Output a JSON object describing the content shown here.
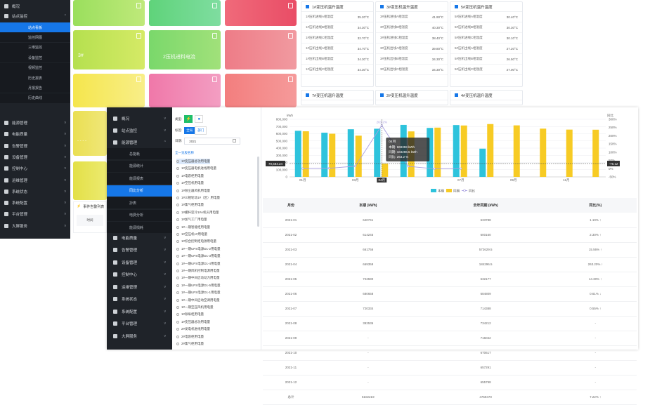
{
  "back": {
    "sidebar": [
      {
        "label": "概况",
        "chev": ""
      },
      {
        "label": "站点监控",
        "chev": "^"
      }
    ],
    "sidebar_sub": [
      "站点看板",
      "监控网图",
      "三维监控",
      "设备监控",
      "视频监控",
      "历史报表",
      "月报报告",
      "历史曲线"
    ],
    "sidebar_bottom": [
      "能源管理",
      "电能质量",
      "告警管理",
      "设备管理",
      "控制中心",
      "运维管理",
      "系统状态",
      "系统配置",
      "平台管理",
      "大屏服务"
    ],
    "tile_text_a": "3#",
    "tile_text_b": "2压机进料电流",
    "event_label": "事件告警列表",
    "event_time": "时间",
    "cards_top": [
      {
        "title": "1#变压机温升温度",
        "rows": [
          {
            "k": "1#压机进线A相温度",
            "v": "35.20°C"
          },
          {
            "k": "1#压机进线B相温度",
            "v": "34.30°C"
          },
          {
            "k": "1#压机进线C相温度",
            "v": "32.70°C"
          },
          {
            "k": "1#压机出线A相温度",
            "v": "34.70°C"
          },
          {
            "k": "1#压机出线B相温度",
            "v": "34.30°C"
          },
          {
            "k": "1#压机出线C相温度",
            "v": "34.30°C"
          }
        ]
      },
      {
        "title": "3#变压机温升温度",
        "rows": [
          {
            "k": "3#压机进线A相温度",
            "v": "41.90°C"
          },
          {
            "k": "3#压机进线B相温度",
            "v": "40.30°C"
          },
          {
            "k": "3#压机进线C相温度",
            "v": "38.40°C"
          },
          {
            "k": "3#压机出线A相温度",
            "v": "39.80°C"
          },
          {
            "k": "3#压机出线B相温度",
            "v": "34.30°C"
          },
          {
            "k": "3#压机出线C相温度",
            "v": "34.30°C"
          }
        ]
      },
      {
        "title": "5#变压机温升温度",
        "rows": [
          {
            "k": "5#压机进线A相温度",
            "v": "30.40°C"
          },
          {
            "k": "5#压机进线B相温度",
            "v": "30.30°C"
          },
          {
            "k": "5#压机进线C相温度",
            "v": "30.10°C"
          },
          {
            "k": "5#压机出线A相温度",
            "v": "27.20°C"
          },
          {
            "k": "5#压机出线B相温度",
            "v": "26.50°C"
          },
          {
            "k": "5#压机出线C相温度",
            "v": "27.00°C"
          }
        ]
      }
    ],
    "cards_bottom": [
      "7#变压机温升温度",
      "2#变压机温升温度",
      "4#变压机温升温度"
    ]
  },
  "front": {
    "sidebar": [
      {
        "label": "概况",
        "chev": "v"
      },
      {
        "label": "站点监控",
        "chev": "v"
      },
      {
        "label": "能源管理",
        "chev": "^"
      }
    ],
    "sidebar_sub": [
      "总能耗",
      "能源统计",
      "能源报表",
      "同比分析",
      "抄表",
      "电费分析",
      "能源损耗"
    ],
    "sidebar_bottom": [
      "电能质量",
      "告警管理",
      "设备管理",
      "控制中心",
      "运维管理",
      "系统状态",
      "系统配置",
      "平台管理",
      "大屏服务"
    ],
    "filter": {
      "type_label": "类型:",
      "tab_label": "标签:",
      "tab_all": "全局",
      "tab_dept": "部门",
      "date_label": "日期:",
      "date_value": "2021"
    },
    "tree_header": "全一览股名称",
    "tree_items": [
      "1#变压器总功用电量",
      "1#变压器电机进线用电量",
      "1#电容柜用电量",
      "1#空压机用电量",
      "1#除尘器风机用电量",
      "1#三相轮动1#（区）用电量",
      "1#集气柜用电量",
      "1#螺杆空冷1#A机头用电量",
      "1#加气工厂用电量",
      "1#一期智能柜用电量",
      "1#空压机1#用电量",
      "1#综合控制柜电源用电量",
      "1#一期UPS电源D1-2用电量",
      "1#一期UPS电源D1-3用电量",
      "1#一期UPS电源D1-4用电量",
      "1#一期风机控制电源用电量",
      "1#一期中间启动动力用电量",
      "1#一期UPS电源D1-5用电量",
      "1#一期UPS电源D1-1用电量",
      "1#一期中间启动空调用电量",
      "1#一期空压风机用电量",
      "1#除垢柜用电量",
      "1#变压器总功用电量",
      "2#发电机进线用电量",
      "2#电容柜用电量",
      "2#集气柜用电量"
    ],
    "tree_selected_index": 0,
    "table": {
      "headers": [
        "月份",
        "本期 (kWh)",
        "去年同期 (kWh)",
        "同比(%)"
      ],
      "rows": [
        [
          "2021-01",
          "640741",
          "633788",
          "1.10% ↑",
          "up"
        ],
        [
          "2021-02",
          "614245",
          "600160",
          "2.30% ↑",
          "up"
        ],
        [
          "2021-03",
          "661756",
          "572629.5",
          "15.56% ↑",
          "up"
        ],
        [
          "2021-04",
          "669359",
          "184296.5",
          "263.20% ↑",
          "up"
        ],
        [
          "2021-05",
          "722590",
          "632177",
          "14.30% ↑",
          "up"
        ],
        [
          "2021-06",
          "680658",
          "684809",
          "0.61% ↓",
          "dn"
        ],
        [
          "2021-07",
          "720334",
          "714388",
          "0.55% ↑",
          "up"
        ],
        [
          "2021-08",
          "392536",
          "734212",
          "-",
          ""
        ],
        [
          "2021-09",
          "-",
          "716042",
          "-",
          ""
        ],
        [
          "2021-10",
          "-",
          "670617",
          "-",
          ""
        ],
        [
          "2021-11",
          "-",
          "657291",
          "-",
          ""
        ],
        [
          "2021-12",
          "-",
          "655798",
          "-",
          ""
        ],
        [
          "总计",
          "5102219",
          "4759470",
          "7.22% ↑",
          "up"
        ]
      ]
    }
  },
  "chart_data": {
    "type": "bar",
    "categories": [
      "01月",
      "02月",
      "03月",
      "04月",
      "05月",
      "06月",
      "07月",
      "08月",
      "09月",
      "10月",
      "11月",
      "12月"
    ],
    "x_tick_labels": [
      "01月",
      "03月",
      "04月",
      "07月",
      "09月",
      "11月"
    ],
    "series": [
      {
        "name": "本期",
        "type": "bar",
        "color": "#2ec3dc",
        "values": [
          640741,
          614245,
          661756,
          669359,
          722590,
          680658,
          720334,
          392536,
          null,
          null,
          null,
          null
        ]
      },
      {
        "name": "同期",
        "type": "bar",
        "color": "#f7cb24",
        "values": [
          633788,
          600160,
          572629.5,
          184296.5,
          632177,
          684809,
          714388,
          734212,
          716042,
          670617,
          657291,
          655798
        ]
      },
      {
        "name": "同比",
        "type": "line",
        "color": "#a89fe0",
        "axis": "right",
        "values": [
          1.1,
          2.3,
          15.56,
          263.2,
          14.3,
          -0.61,
          0.55,
          null,
          null,
          null,
          null,
          null
        ]
      }
    ],
    "ylabel_left": "kWh",
    "ylabel_right": "同比",
    "ylim": [
      0,
      800000
    ],
    "y_ticks": [
      "800,000",
      "700,000",
      "600,000",
      "500,000",
      "400,000",
      "300,000",
      "200,000",
      "100,000",
      "0"
    ],
    "y2_ticks": [
      "300%",
      "250%",
      "200%",
      "150%",
      "100%",
      "50%",
      "0%",
      "-50%"
    ],
    "y2lim": [
      -50,
      300
    ],
    "peak_label": "263.2%",
    "tooltip": {
      "title": "04月",
      "lines": [
        "本期: 669359 kWh",
        "同期: 184296.5 kWh",
        "同比: 263.2 %"
      ]
    },
    "crosshair_left": "70,584.24",
    "crosshair_right": "-76.12",
    "crosshair_x": "04月",
    "legend": [
      "本期",
      "同期",
      "同比"
    ],
    "legend_position": "bottom"
  }
}
